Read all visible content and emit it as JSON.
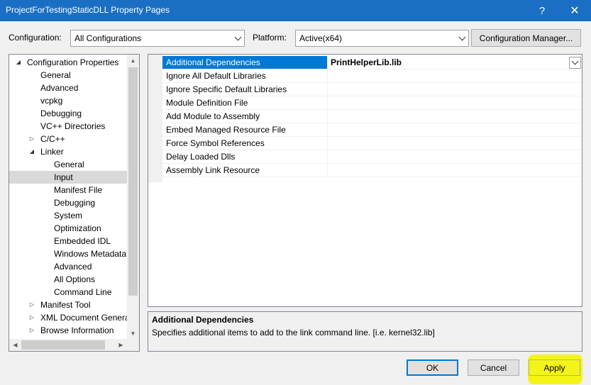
{
  "window": {
    "title": "ProjectForTestingStaticDLL Property Pages",
    "help_glyph": "?",
    "close_glyph": "✕"
  },
  "config": {
    "configuration_label": "Configuration:",
    "configuration_value": "All Configurations",
    "platform_label": "Platform:",
    "platform_value": "Active(x64)",
    "manager_button": "Configuration Manager..."
  },
  "tree": {
    "items": [
      {
        "label": "Configuration Properties",
        "level": 0,
        "expander": "expanded"
      },
      {
        "label": "General",
        "level": 1
      },
      {
        "label": "Advanced",
        "level": 1
      },
      {
        "label": "vcpkg",
        "level": 1
      },
      {
        "label": "Debugging",
        "level": 1
      },
      {
        "label": "VC++ Directories",
        "level": 1
      },
      {
        "label": "C/C++",
        "level": 1,
        "expander": "collapsed"
      },
      {
        "label": "Linker",
        "level": 1,
        "expander": "expanded"
      },
      {
        "label": "General",
        "level": 2
      },
      {
        "label": "Input",
        "level": 2,
        "selected": true
      },
      {
        "label": "Manifest File",
        "level": 2
      },
      {
        "label": "Debugging",
        "level": 2
      },
      {
        "label": "System",
        "level": 2
      },
      {
        "label": "Optimization",
        "level": 2
      },
      {
        "label": "Embedded IDL",
        "level": 2
      },
      {
        "label": "Windows Metadata",
        "level": 2
      },
      {
        "label": "Advanced",
        "level": 2
      },
      {
        "label": "All Options",
        "level": 2
      },
      {
        "label": "Command Line",
        "level": 2
      },
      {
        "label": "Manifest Tool",
        "level": 1,
        "expander": "collapsed"
      },
      {
        "label": "XML Document Genera",
        "level": 1,
        "expander": "collapsed"
      },
      {
        "label": "Browse Information",
        "level": 1,
        "expander": "collapsed"
      }
    ]
  },
  "properties": [
    {
      "name": "Additional Dependencies",
      "value": "PrintHelperLib.lib",
      "selected": true
    },
    {
      "name": "Ignore All Default Libraries",
      "value": ""
    },
    {
      "name": "Ignore Specific Default Libraries",
      "value": ""
    },
    {
      "name": "Module Definition File",
      "value": ""
    },
    {
      "name": "Add Module to Assembly",
      "value": ""
    },
    {
      "name": "Embed Managed Resource File",
      "value": ""
    },
    {
      "name": "Force Symbol References",
      "value": ""
    },
    {
      "name": "Delay Loaded Dlls",
      "value": ""
    },
    {
      "name": "Assembly Link Resource",
      "value": ""
    }
  ],
  "description": {
    "title": "Additional Dependencies",
    "text": "Specifies additional items to add to the link command line. [i.e. kernel32.lib]"
  },
  "buttons": {
    "ok": "OK",
    "cancel": "Cancel",
    "apply": "Apply"
  },
  "colors": {
    "titlebar": "#1a6fc4",
    "selection": "#0078d7",
    "highlight": "#f4f400"
  }
}
